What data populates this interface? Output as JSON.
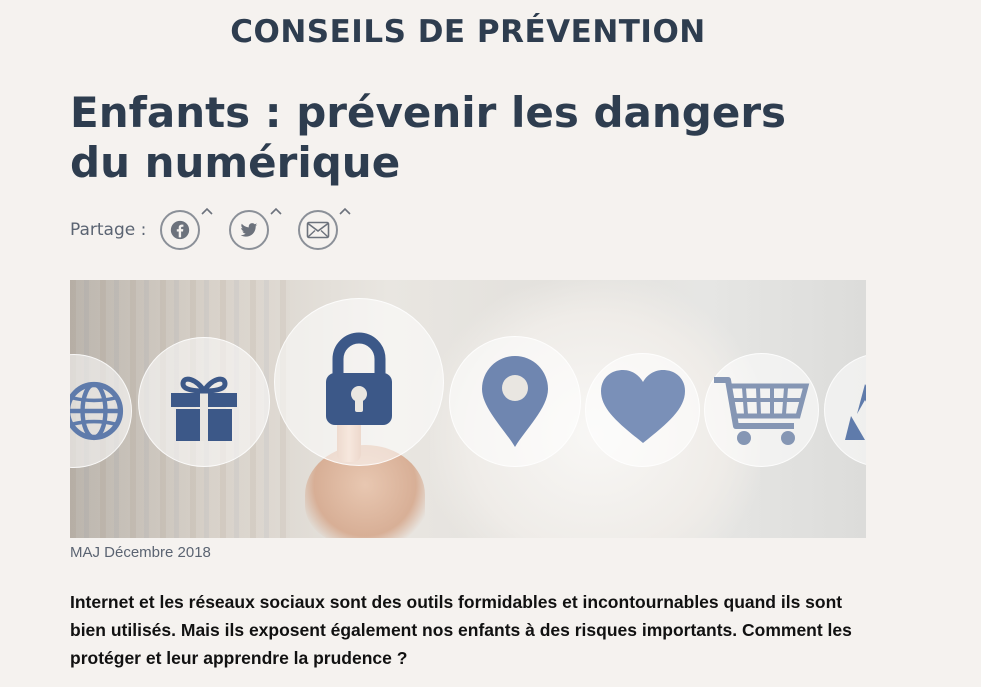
{
  "section": {
    "title": "CONSEILS DE PRÉVENTION"
  },
  "article": {
    "title": "Enfants : prévenir les dangers du numérique",
    "share_label": "Partage :",
    "share_buttons": [
      {
        "icon": "facebook-icon"
      },
      {
        "icon": "twitter-icon"
      },
      {
        "icon": "mail-icon"
      }
    ],
    "image_icons": [
      "globe-icon",
      "gift-icon",
      "lock-icon",
      "location-pin-icon",
      "heart-icon",
      "shopping-cart-icon",
      "recycle-icon"
    ],
    "caption": "MAJ Décembre 2018",
    "intro": "Internet et les réseaux sociaux sont des outils formidables et incontournables quand ils sont bien utilisés. Mais ils exposent également nos enfants à des risques importants. Comment les protéger et leur apprendre la prudence ?"
  },
  "colors": {
    "background": "#f5f2ef",
    "heading": "#2e3d4f",
    "icon_blue": "#6f86b0",
    "icon_blue_dark": "#3c5888"
  }
}
